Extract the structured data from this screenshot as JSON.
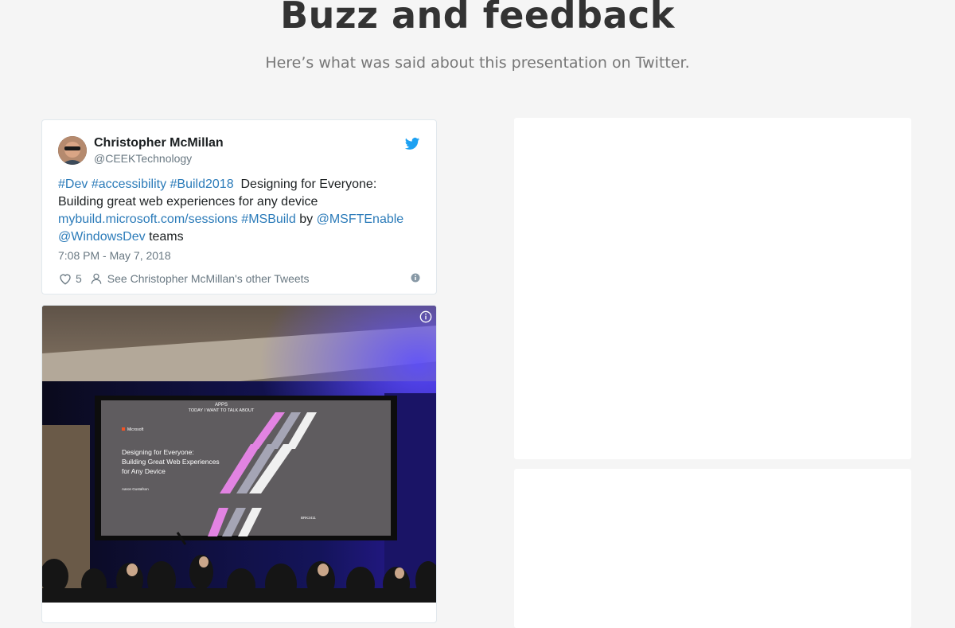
{
  "section": {
    "title": "Buzz and feedback",
    "subtitle": "Here’s what was said about this presentation on Twitter."
  },
  "tweet": {
    "author_name": "Christopher McMillan",
    "author_handle": "@CEEKTechnology",
    "text_segments": {
      "h_dev": "#Dev",
      "h_accessibility": "#accessibility",
      "h_build2018": "#Build2018",
      "t1": "Designing for Everyone: Building great web experiences for any device",
      "link": "mybuild.microsoft.com/sessions",
      "h_msbuild": "#MSBuild",
      "t_by": "by",
      "m_msftenable": "@MSFTEnable",
      "m_windowsdev": "@WindowsDev",
      "t_teams": "teams"
    },
    "timestamp": "7:08 PM - May 7, 2018",
    "like_count": "5",
    "other_tweets_link": "See Christopher McMillan's other Tweets"
  },
  "slide": {
    "apps": "APPS",
    "intro": "TODAY I WANT TO TALK ABOUT",
    "brand": "Microsoft",
    "line1": "Designing for Everyone:",
    "line2": "Building Great Web Experiences",
    "line3": "for Any Device",
    "presenter": "Aaron Gustafson",
    "code": "BRK2411"
  },
  "colors": {
    "twitter_blue": "#1da1f2",
    "link_blue": "#2b7bb9"
  }
}
